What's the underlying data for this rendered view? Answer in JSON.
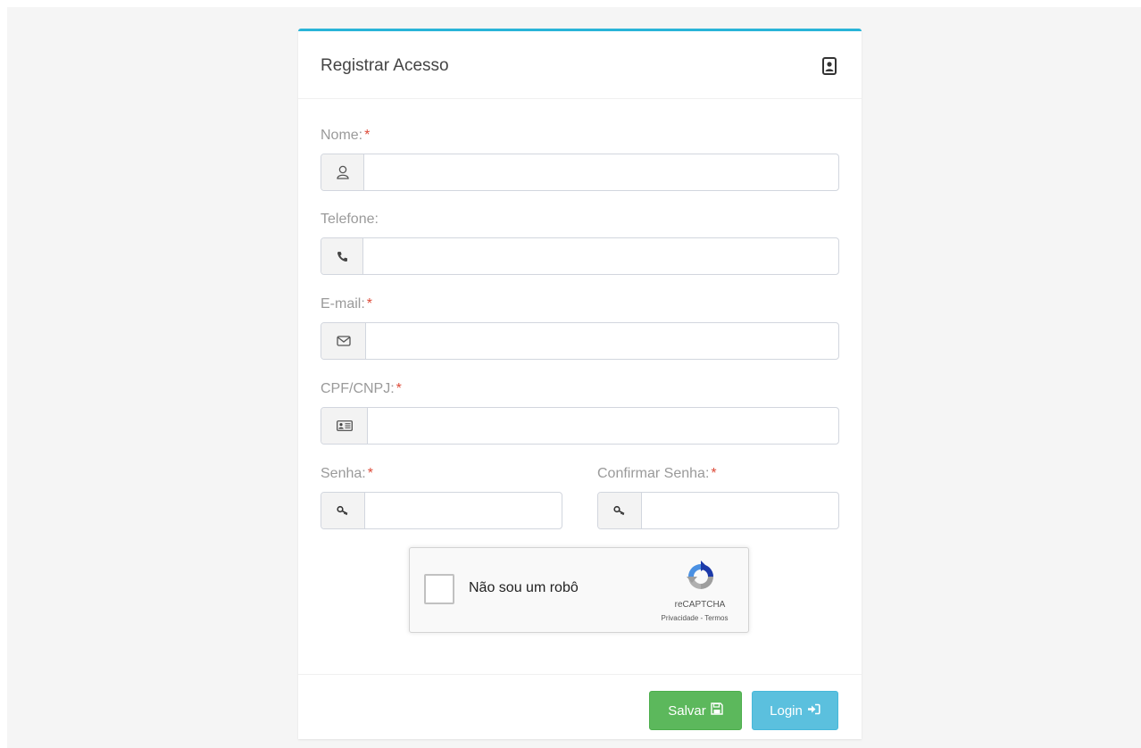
{
  "form": {
    "title": "Registrar Acesso",
    "header_icon": "contact-card-icon"
  },
  "fields": {
    "nome": {
      "label": "Nome:",
      "required_mark": "*",
      "value": "",
      "icon": "user-icon"
    },
    "telefone": {
      "label": "Telefone:",
      "value": "",
      "icon": "phone-icon"
    },
    "email": {
      "label": "E-mail:",
      "required_mark": "*",
      "value": "",
      "icon": "envelope-icon"
    },
    "cpf_cnpj": {
      "label": "CPF/CNPJ:",
      "required_mark": "*",
      "value": "",
      "icon": "id-card-icon"
    },
    "senha": {
      "label": "Senha:",
      "required_mark": "*",
      "value": "",
      "icon": "key-icon"
    },
    "confirmar_senha": {
      "label": "Confirmar Senha:",
      "required_mark": "*",
      "value": "",
      "icon": "key-icon"
    }
  },
  "captcha": {
    "label": "Não sou um robô",
    "brand": "reCAPTCHA",
    "links": "Privacidade - Termos"
  },
  "buttons": {
    "save_label": "Salvar",
    "login_label": "Login"
  },
  "colors": {
    "accent_top": "#29b4d8",
    "required": "#dd4b39",
    "save": "#5cb85c",
    "login": "#5bc0de"
  }
}
